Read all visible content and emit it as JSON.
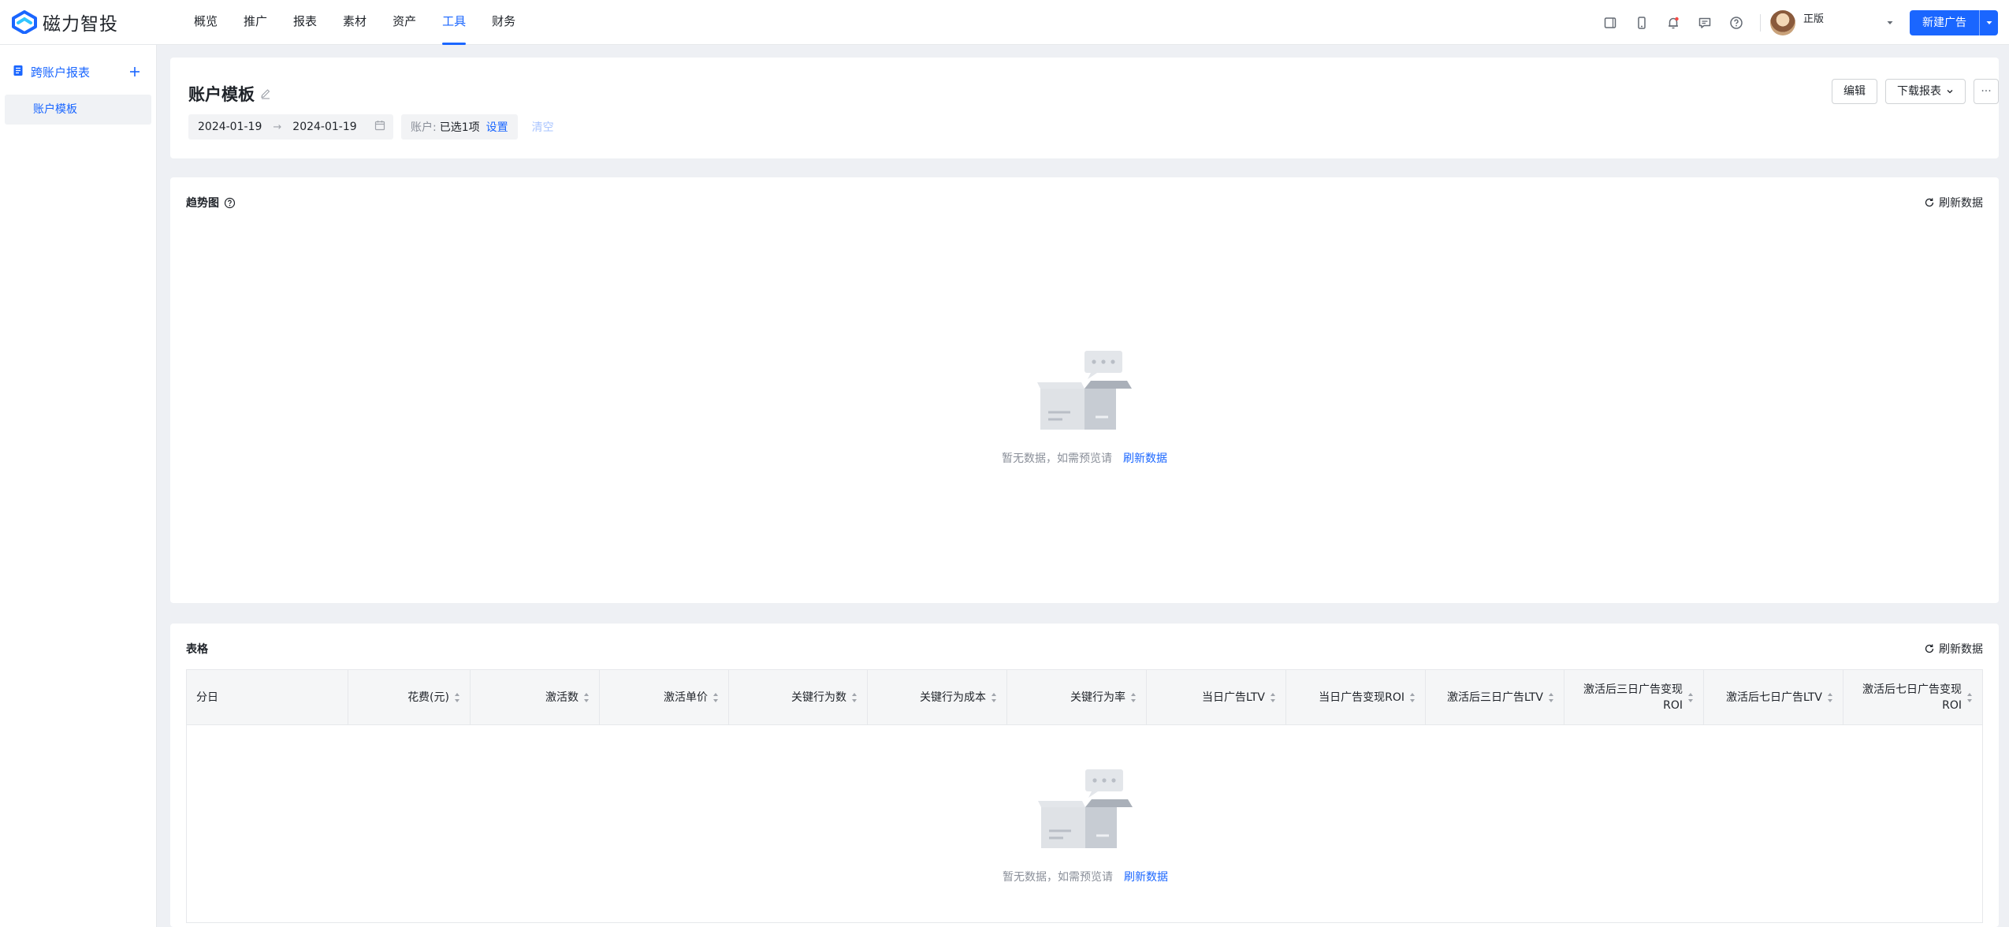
{
  "app": {
    "name": "磁力智投"
  },
  "nav": {
    "items": [
      {
        "label": "概览",
        "active": false
      },
      {
        "label": "推广",
        "active": false
      },
      {
        "label": "报表",
        "active": false
      },
      {
        "label": "素材",
        "active": false
      },
      {
        "label": "资产",
        "active": false
      },
      {
        "label": "工具",
        "active": true
      },
      {
        "label": "财务",
        "active": false
      }
    ]
  },
  "topbar": {
    "user_tag": "正版",
    "new_ad_label": "新建广告",
    "icons": [
      "tablet-icon",
      "mobile-icon",
      "bell-icon",
      "message-icon",
      "help-icon"
    ]
  },
  "sidebar": {
    "section_label": "跨账户报表",
    "items": [
      {
        "label": "账户模板",
        "active": true
      }
    ]
  },
  "header": {
    "title": "账户模板",
    "edit_label": "编辑",
    "download_label": "下载报表",
    "more_label": "···",
    "date_start": "2024-01-19",
    "date_end": "2024-01-19",
    "account_label": "账户:",
    "account_value": "已选1项",
    "account_set": "设置",
    "clear_label": "清空"
  },
  "trend": {
    "title": "趋势图",
    "refresh_label": "刷新数据",
    "empty_text": "暂无数据，如需预览请",
    "empty_link": "刷新数据"
  },
  "table": {
    "title": "表格",
    "refresh_label": "刷新数据",
    "columns": [
      "分日",
      "花费(元)",
      "激活数",
      "激活单价",
      "关键行为数",
      "关键行为成本",
      "关键行为率",
      "当日广告LTV",
      "当日广告变现ROI",
      "激活后三日广告LTV",
      "激活后三日广告变现ROI",
      "激活后七日广告LTV",
      "激活后七日广告变现ROI"
    ],
    "empty_text": "暂无数据，如需预览请",
    "empty_link": "刷新数据"
  },
  "colors": {
    "accent": "#1a66ff"
  }
}
